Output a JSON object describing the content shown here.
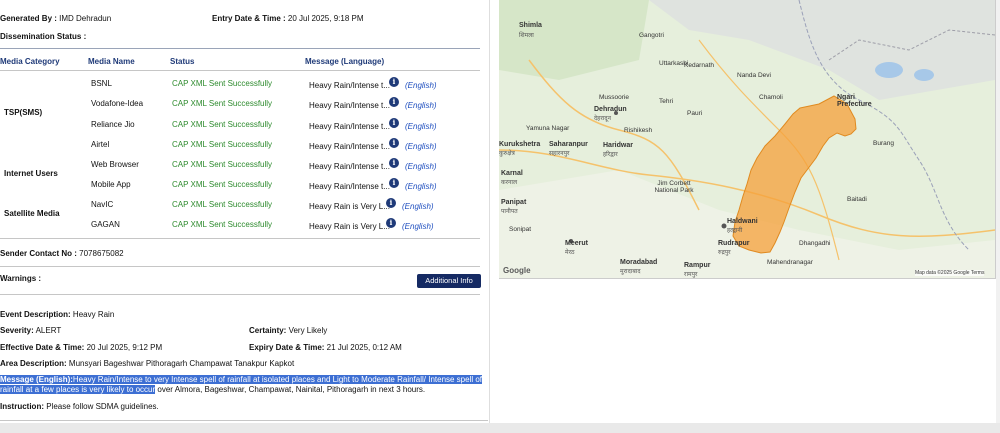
{
  "generated_by": {
    "label": "Generated By :",
    "value": "IMD Dehradun"
  },
  "entry_datetime": {
    "label": "Entry Date & Time :",
    "value": "20 Jul 2025, 9:18 PM"
  },
  "dissemination_label": "Dissemination Status :",
  "table": {
    "headers": [
      "Media Category",
      "Media Name",
      "Status",
      "Message (Language)"
    ],
    "categories": [
      "TSP(SMS)",
      "Internet Users",
      "Satellite Media"
    ],
    "rows": [
      {
        "media": "BSNL",
        "status": "CAP XML Sent Successfully",
        "message": "Heavy Rain/Intense t...",
        "lang": "(English)"
      },
      {
        "media": "Vodafone-Idea",
        "status": "CAP XML Sent Successfully",
        "message": "Heavy Rain/Intense t...",
        "lang": "(English)"
      },
      {
        "media": "Reliance Jio",
        "status": "CAP XML Sent Successfully",
        "message": "Heavy Rain/Intense t...",
        "lang": "(English)"
      },
      {
        "media": "Airtel",
        "status": "CAP XML Sent Successfully",
        "message": "Heavy Rain/Intense t...",
        "lang": "(English)"
      },
      {
        "media": "Web Browser",
        "status": "CAP XML Sent Successfully",
        "message": "Heavy Rain/Intense t...",
        "lang": "(English)"
      },
      {
        "media": "Mobile App",
        "status": "CAP XML Sent Successfully",
        "message": "Heavy Rain/Intense t...",
        "lang": "(English)"
      },
      {
        "media": "NavIC",
        "status": "CAP XML Sent Successfully",
        "message": "Heavy Rain is Very L...",
        "lang": "(English)"
      },
      {
        "media": "GAGAN",
        "status": "CAP XML Sent Successfully",
        "message": "Heavy Rain is Very L...",
        "lang": "(English)"
      }
    ]
  },
  "info_icon_glyph": "i",
  "sender_contact": {
    "label": "Sender Contact No :",
    "value": "7078675082"
  },
  "warnings_label": "Warnings :",
  "additional_info_button": "Additional Info",
  "event": {
    "label": "Event Description:",
    "value": "Heavy Rain"
  },
  "severity": {
    "label": "Severity:",
    "value": "ALERT"
  },
  "certainty": {
    "label": "Certainty:",
    "value": "Very Likely"
  },
  "effective": {
    "label": "Effective Date & Time:",
    "value": "20 Jul 2025, 9:12 PM"
  },
  "expiry": {
    "label": "Expiry Date & Time:",
    "value": "21 Jul 2025, 0:12 AM"
  },
  "area": {
    "label": "Area Description:",
    "value": "Munsyari Bageshwar Pithoragarh Champawat Tanakpur Kapkot"
  },
  "message": {
    "label": "Message (English):",
    "highlight_line1": "Heavy Rain/Intense to very Intense spell of rainfall at isolated places and Light to Moderate Rainfall/ Intense spell of",
    "highlight_line2": "rainfall at a few places is very likely to occur",
    "rest_line2": "over Almora, Bageshwar, Champawat, Nainital, Pithoragarh in next 3 hours."
  },
  "instruction": {
    "label": "Instruction:",
    "value": "Please follow SDMA guidelines."
  },
  "map": {
    "labels": [
      {
        "t": "Shimla",
        "d": "शिमला"
      },
      {
        "t": "Gangotri"
      },
      {
        "t": "Dehradun",
        "d": "देहरादून"
      },
      {
        "t": "Uttarkashi"
      },
      {
        "t": "Kedarnath"
      },
      {
        "t": "Nanda Devi"
      },
      {
        "t": "Chamoli"
      },
      {
        "t": "Mussoorie"
      },
      {
        "t": "Rishikesh"
      },
      {
        "t": "Haridwar",
        "d": "हरिद्वार"
      },
      {
        "t": "Saharanpur",
        "d": "सहारनपुर"
      },
      {
        "t": "Kurukshetra",
        "d": "कुरुक्षेत्र"
      },
      {
        "t": "Karnal",
        "d": "करनाल"
      },
      {
        "t": "Panipat",
        "d": "पानीपत"
      },
      {
        "t": "Meerut",
        "d": "मेरठ"
      },
      {
        "t": "Moradabad",
        "d": "मुरादाबाद"
      },
      {
        "t": "Rampur",
        "d": "रामपुर"
      },
      {
        "t": "Rudrapur",
        "d": "रुद्रपुर"
      },
      {
        "t": "Haldwani",
        "d": "हल्द्वानी"
      },
      {
        "t": "Ngari Prefecture"
      },
      {
        "t": "Burang"
      },
      {
        "t": "Mahendranagar"
      },
      {
        "t": "Baitadi"
      },
      {
        "t": "Dhangadhi"
      },
      {
        "t": "Jim Corbett National Park"
      },
      {
        "t": "Yamuna Nagar"
      },
      {
        "t": "Sonipat"
      },
      {
        "t": "Tehri"
      },
      {
        "t": "Pauri"
      }
    ],
    "google": "Google",
    "attribution": "Map data ©2025 Google   Terms"
  },
  "colors": {
    "accent": "#1f3a78",
    "status_green": "#2e8b2e",
    "alert_area": "#f5a03a",
    "highlight": "#3d6fd3"
  }
}
